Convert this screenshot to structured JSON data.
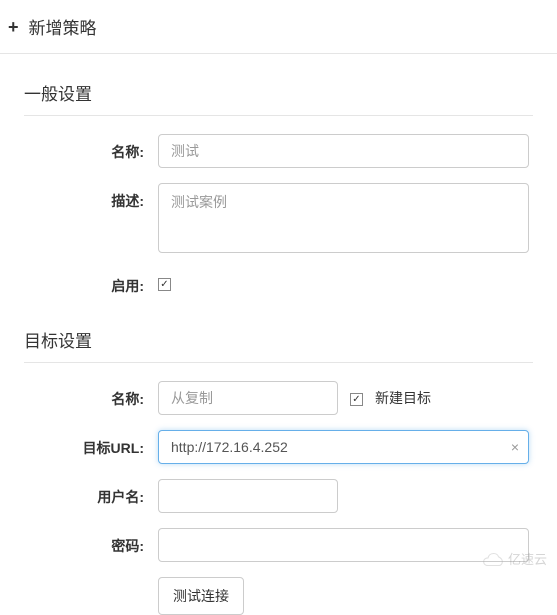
{
  "header": {
    "title": "新增策略"
  },
  "sections": {
    "general": {
      "title": "一般设置",
      "name_label": "名称:",
      "name_placeholder": "测试",
      "desc_label": "描述:",
      "desc_placeholder": "测试案例",
      "enable_label": "启用:"
    },
    "target": {
      "title": "目标设置",
      "name_label": "名称:",
      "name_placeholder": "从复制",
      "new_target_label": "新建目标",
      "url_label": "目标URL:",
      "url_value": "http://172.16.4.252",
      "user_label": "用户名:",
      "password_label": "密码:",
      "test_button": "测试连接"
    }
  },
  "watermark": {
    "text": "亿速云"
  }
}
